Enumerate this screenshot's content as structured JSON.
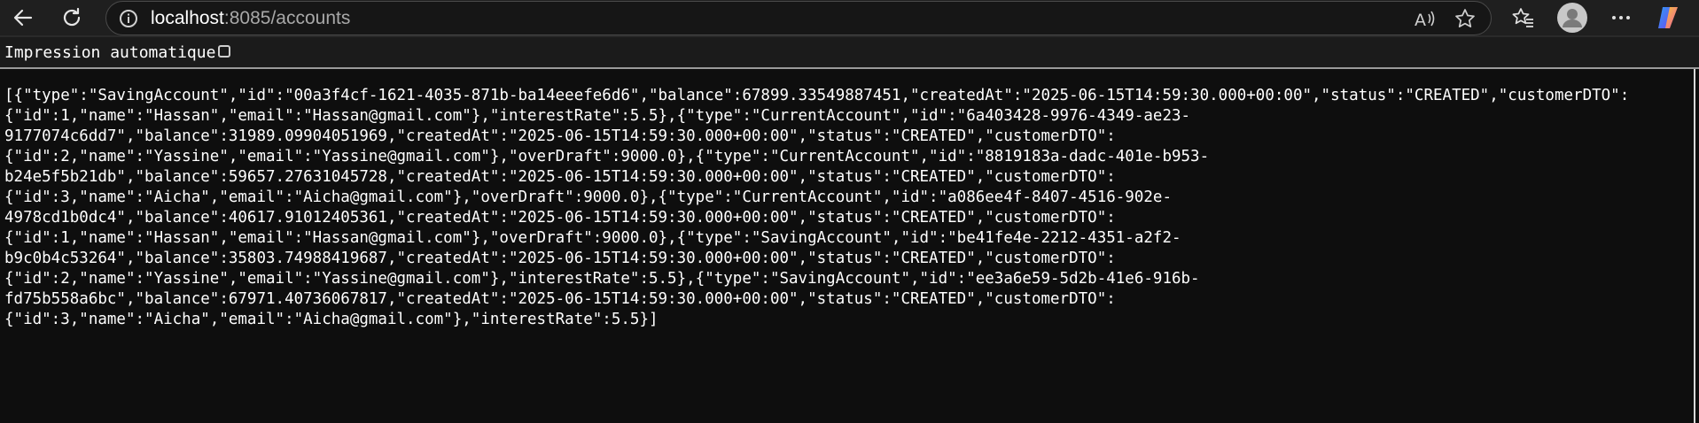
{
  "browser": {
    "url_host": "localhost",
    "url_rest": ":8085/accounts",
    "icons": [
      "back-icon",
      "refresh-icon",
      "site-info-icon",
      "read-aloud-icon",
      "favorite-star-icon",
      "favorites-icon",
      "profile-icon",
      "more-icon",
      "copilot-icon"
    ]
  },
  "pretty_print": {
    "label": "Impression automatique",
    "checked": false
  },
  "json_lines": [
    "[{\"type\":\"SavingAccount\",\"id\":\"00a3f4cf-1621-4035-871b-ba14eeefe6d6\",\"balance\":67899.33549887451,\"createdAt\":\"2025-06-15T14:59:30.000+00:00\",\"status\":\"CREATED\",\"customerDTO\":",
    "{\"id\":1,\"name\":\"Hassan\",\"email\":\"Hassan@gmail.com\"},\"interestRate\":5.5},{\"type\":\"CurrentAccount\",\"id\":\"6a403428-9976-4349-ae23-",
    "9177074c6dd7\",\"balance\":31989.09904051969,\"createdAt\":\"2025-06-15T14:59:30.000+00:00\",\"status\":\"CREATED\",\"customerDTO\":",
    "{\"id\":2,\"name\":\"Yassine\",\"email\":\"Yassine@gmail.com\"},\"overDraft\":9000.0},{\"type\":\"CurrentAccount\",\"id\":\"8819183a-dadc-401e-b953-",
    "b24e5f5b21db\",\"balance\":59657.27631045728,\"createdAt\":\"2025-06-15T14:59:30.000+00:00\",\"status\":\"CREATED\",\"customerDTO\":",
    "{\"id\":3,\"name\":\"Aicha\",\"email\":\"Aicha@gmail.com\"},\"overDraft\":9000.0},{\"type\":\"CurrentAccount\",\"id\":\"a086ee4f-8407-4516-902e-",
    "4978cd1b0dc4\",\"balance\":40617.91012405361,\"createdAt\":\"2025-06-15T14:59:30.000+00:00\",\"status\":\"CREATED\",\"customerDTO\":",
    "{\"id\":1,\"name\":\"Hassan\",\"email\":\"Hassan@gmail.com\"},\"overDraft\":9000.0},{\"type\":\"SavingAccount\",\"id\":\"be41fe4e-2212-4351-a2f2-",
    "b9c0b4c53264\",\"balance\":35803.74988419687,\"createdAt\":\"2025-06-15T14:59:30.000+00:00\",\"status\":\"CREATED\",\"customerDTO\":",
    "{\"id\":2,\"name\":\"Yassine\",\"email\":\"Yassine@gmail.com\"},\"interestRate\":5.5},{\"type\":\"SavingAccount\",\"id\":\"ee3a6e59-5d2b-41e6-916b-",
    "fd75b558a6bc\",\"balance\":67971.40736067817,\"createdAt\":\"2025-06-15T14:59:30.000+00:00\",\"status\":\"CREATED\",\"customerDTO\":",
    "{\"id\":3,\"name\":\"Aicha\",\"email\":\"Aicha@gmail.com\"},\"interestRate\":5.5}]"
  ]
}
